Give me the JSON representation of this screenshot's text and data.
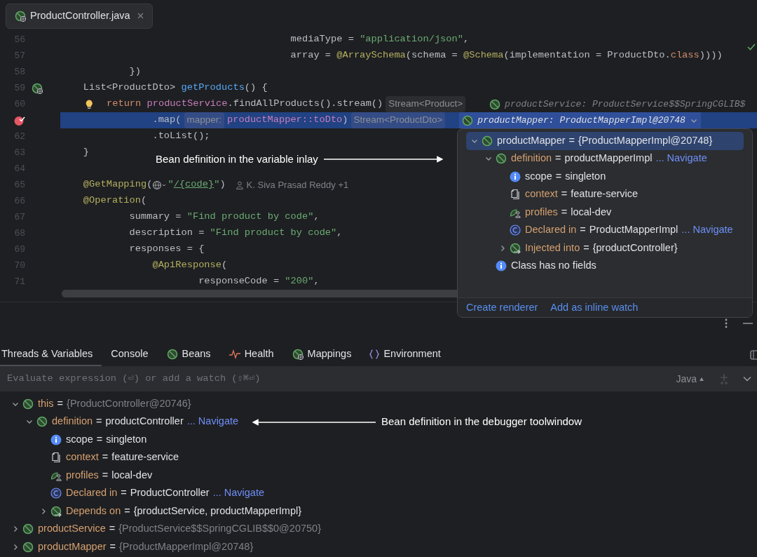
{
  "editor_tab": {
    "label": "ProductController.java",
    "selected": true
  },
  "code": [
    {
      "kind": "plain",
      "number": "56",
      "tokens": [
        {
          "kind": "p",
          "text": "                                        mediaType = "
        },
        {
          "kind": "str",
          "text": "\"application/json\""
        },
        {
          "kind": "p",
          "text": ","
        }
      ]
    },
    {
      "kind": "plain",
      "number": "57",
      "tokens": [
        {
          "kind": "p",
          "text": "                                        array = "
        },
        {
          "kind": "ann",
          "text": "@ArraySchema"
        },
        {
          "kind": "p",
          "text": "(schema = "
        },
        {
          "kind": "ann",
          "text": "@Schema"
        },
        {
          "kind": "p",
          "text": "(implementation = ProductDto."
        },
        {
          "kind": "kw",
          "text": "class"
        },
        {
          "kind": "p",
          "text": "))))"
        }
      ]
    },
    {
      "kind": "plain",
      "number": "58",
      "tokens": [
        {
          "kind": "p",
          "text": "            })"
        }
      ]
    },
    {
      "kind": "bean",
      "number": "59",
      "tokens": [
        {
          "kind": "p",
          "text": "    List<ProductDto> "
        },
        {
          "kind": "fn",
          "text": "getProducts"
        },
        {
          "kind": "p",
          "text": "() {"
        }
      ]
    },
    {
      "kind": "plain",
      "number": "60",
      "tokens": [
        {
          "kind": "bulb"
        },
        {
          "kind": "kw",
          "text": "return "
        },
        {
          "kind": "fld",
          "text": "productService"
        },
        {
          "kind": "p",
          "text": ".findAllProducts().stream()"
        },
        {
          "kind": "hint",
          "text": "Stream<Product>"
        },
        {
          "kind": "inlay",
          "text": "productService: ProductService$$SpringCGLIB$"
        }
      ]
    },
    {
      "kind": "breakpoint",
      "highlighted": true,
      "tokens": [
        {
          "kind": "p",
          "text": "                .map("
        },
        {
          "kind": "hint",
          "text": "mapper:"
        },
        {
          "kind": "fld",
          "text": "productMapper::toDto"
        },
        {
          "kind": "p",
          "text": ")"
        },
        {
          "kind": "hint",
          "text": "Stream<ProductDto>"
        },
        {
          "kind": "inlay",
          "text": "productMapper: ProductMapperImpl@20748",
          "expanded": true
        }
      ]
    },
    {
      "kind": "plain",
      "number": "62",
      "tokens": [
        {
          "kind": "p",
          "text": "                .toList();"
        }
      ]
    },
    {
      "kind": "plain",
      "number": "63",
      "tokens": [
        {
          "kind": "p",
          "text": "    }"
        }
      ]
    },
    {
      "kind": "plain",
      "number": "64"
    },
    {
      "kind": "plain",
      "number": "65",
      "tokens": [
        {
          "kind": "ann",
          "text": "    @GetMapping"
        },
        {
          "kind": "p",
          "text": "("
        },
        {
          "kind": "globe"
        },
        {
          "kind": "str",
          "text": "\""
        },
        {
          "kind": "url",
          "text": "/{code}"
        },
        {
          "kind": "str",
          "text": "\""
        },
        {
          "kind": "p",
          "text": ")"
        },
        {
          "kind": "author",
          "text": "K. Siva Prasad Reddy +1"
        }
      ]
    },
    {
      "kind": "plain",
      "number": "66",
      "tokens": [
        {
          "kind": "ann",
          "text": "    @Operation"
        },
        {
          "kind": "p",
          "text": "("
        }
      ]
    },
    {
      "kind": "plain",
      "number": "67",
      "tokens": [
        {
          "kind": "p",
          "text": "            summary = "
        },
        {
          "kind": "str",
          "text": "\"Find product by code\""
        },
        {
          "kind": "p",
          "text": ","
        }
      ]
    },
    {
      "kind": "plain",
      "number": "68",
      "tokens": [
        {
          "kind": "p",
          "text": "            description = "
        },
        {
          "kind": "str",
          "text": "\"Find product by code\""
        },
        {
          "kind": "p",
          "text": ","
        }
      ]
    },
    {
      "kind": "plain",
      "number": "69",
      "tokens": [
        {
          "kind": "p",
          "text": "            responses = {"
        }
      ]
    },
    {
      "kind": "plain",
      "number": "70",
      "tokens": [
        {
          "kind": "ann",
          "text": "                @ApiResponse"
        },
        {
          "kind": "p",
          "text": "("
        }
      ]
    },
    {
      "kind": "plain",
      "number": "71",
      "tokens": [
        {
          "kind": "p",
          "text": "                        responseCode = "
        },
        {
          "kind": "str",
          "text": "\"200\""
        },
        {
          "kind": "p",
          "text": ","
        }
      ]
    }
  ],
  "annotations": [
    {
      "text": "Bean definition in the variable inlay",
      "kind": "right"
    },
    {
      "text": "Bean definition in the debugger toolwindow",
      "kind": "left"
    }
  ],
  "popup": {
    "tree": [
      {
        "kind": "bean",
        "name": "productMapper",
        "color": "#dfe1e5",
        "sep": "=",
        "value": "{ProductMapperImpl@20748}",
        "muted": false,
        "selected": true,
        "expanded": true,
        "children": [
          {
            "kind": "bean",
            "name": "definition",
            "color": "#d5a070",
            "sep": "=",
            "value": "productMapperImpl",
            "muted": false,
            "link": "... Navigate",
            "selected": false,
            "expanded": true,
            "children": [
              {
                "kind": "info",
                "name": "scope",
                "color": "#dfe1e5",
                "sep": "=",
                "value": "singleton",
                "muted": false,
                "selected": false
              },
              {
                "kind": "context",
                "name": "context",
                "color": "#d5a070",
                "sep": "=",
                "value": "feature-service",
                "muted": false,
                "selected": false
              },
              {
                "kind": "profiles",
                "name": "profiles",
                "color": "#d5a070",
                "sep": "=",
                "value": "local-dev",
                "muted": false,
                "selected": false
              },
              {
                "kind": "class",
                "name": "Declared in",
                "color": "#d5a070",
                "sep": "=",
                "value": "ProductMapperImpl",
                "muted": false,
                "link": "... Navigate",
                "selected": false
              },
              {
                "kind": "inject",
                "name": "Injected into",
                "color": "#d5a070",
                "sep": "=",
                "value": "{productController}",
                "muted": false,
                "selected": false,
                "expanded": false
              }
            ]
          },
          {
            "kind": "info",
            "name": "Class has no fields",
            "color": "#dfe1e5",
            "selected": false
          }
        ]
      }
    ],
    "links": [
      "Create renderer",
      "Add as inline watch"
    ]
  },
  "tool_tabs": [
    {
      "label": "Threads & Variables",
      "kind": "none",
      "selected": true
    },
    {
      "label": "Console",
      "kind": "none",
      "selected": false
    },
    {
      "label": "Beans",
      "kind": "bean",
      "selected": false
    },
    {
      "label": "Health",
      "kind": "health",
      "selected": false
    },
    {
      "label": "Mappings",
      "kind": "mappings",
      "selected": false
    },
    {
      "label": "Environment",
      "kind": "braces",
      "selected": false
    }
  ],
  "evaluate": {
    "placeholder": "Evaluate expression (⏎) or add a watch (⇧⌘⏎)",
    "language": "Java"
  },
  "variables": [
    {
      "kind": "bean",
      "name": "this",
      "color": "#d5a070",
      "sep": "=",
      "value": "{ProductController@20746}",
      "muted": true,
      "expanded": true,
      "children": [
        {
          "kind": "bean",
          "name": "definition",
          "color": "#d5a070",
          "sep": "=",
          "value": "productController",
          "muted": false,
          "link": "... Navigate",
          "expanded": true,
          "children": [
            {
              "kind": "info",
              "name": "scope",
              "color": "#dfe1e5",
              "sep": "=",
              "value": "singleton",
              "muted": false
            },
            {
              "kind": "context",
              "name": "context",
              "color": "#d5a070",
              "sep": "=",
              "value": "feature-service",
              "muted": false
            },
            {
              "kind": "profiles",
              "name": "profiles",
              "color": "#d5a070",
              "sep": "=",
              "value": "local-dev",
              "muted": false
            },
            {
              "kind": "class",
              "name": "Declared in",
              "color": "#d5a070",
              "sep": "=",
              "value": "ProductController",
              "muted": false,
              "link": "... Navigate"
            },
            {
              "kind": "inject",
              "name": "Depends on",
              "color": "#d5a070",
              "sep": "=",
              "value": "{productService, productMapperImpl}",
              "muted": false,
              "expanded": false
            }
          ]
        }
      ]
    },
    {
      "kind": "bean",
      "name": "productService",
      "color": "#d5a070",
      "sep": "=",
      "value": "{ProductService$$SpringCGLIB$$0@20750}",
      "muted": true,
      "expanded": false
    },
    {
      "kind": "bean",
      "name": "productMapper",
      "color": "#d5a070",
      "sep": "=",
      "value": "{ProductMapperImpl@20748}",
      "muted": true,
      "expanded": false
    }
  ]
}
